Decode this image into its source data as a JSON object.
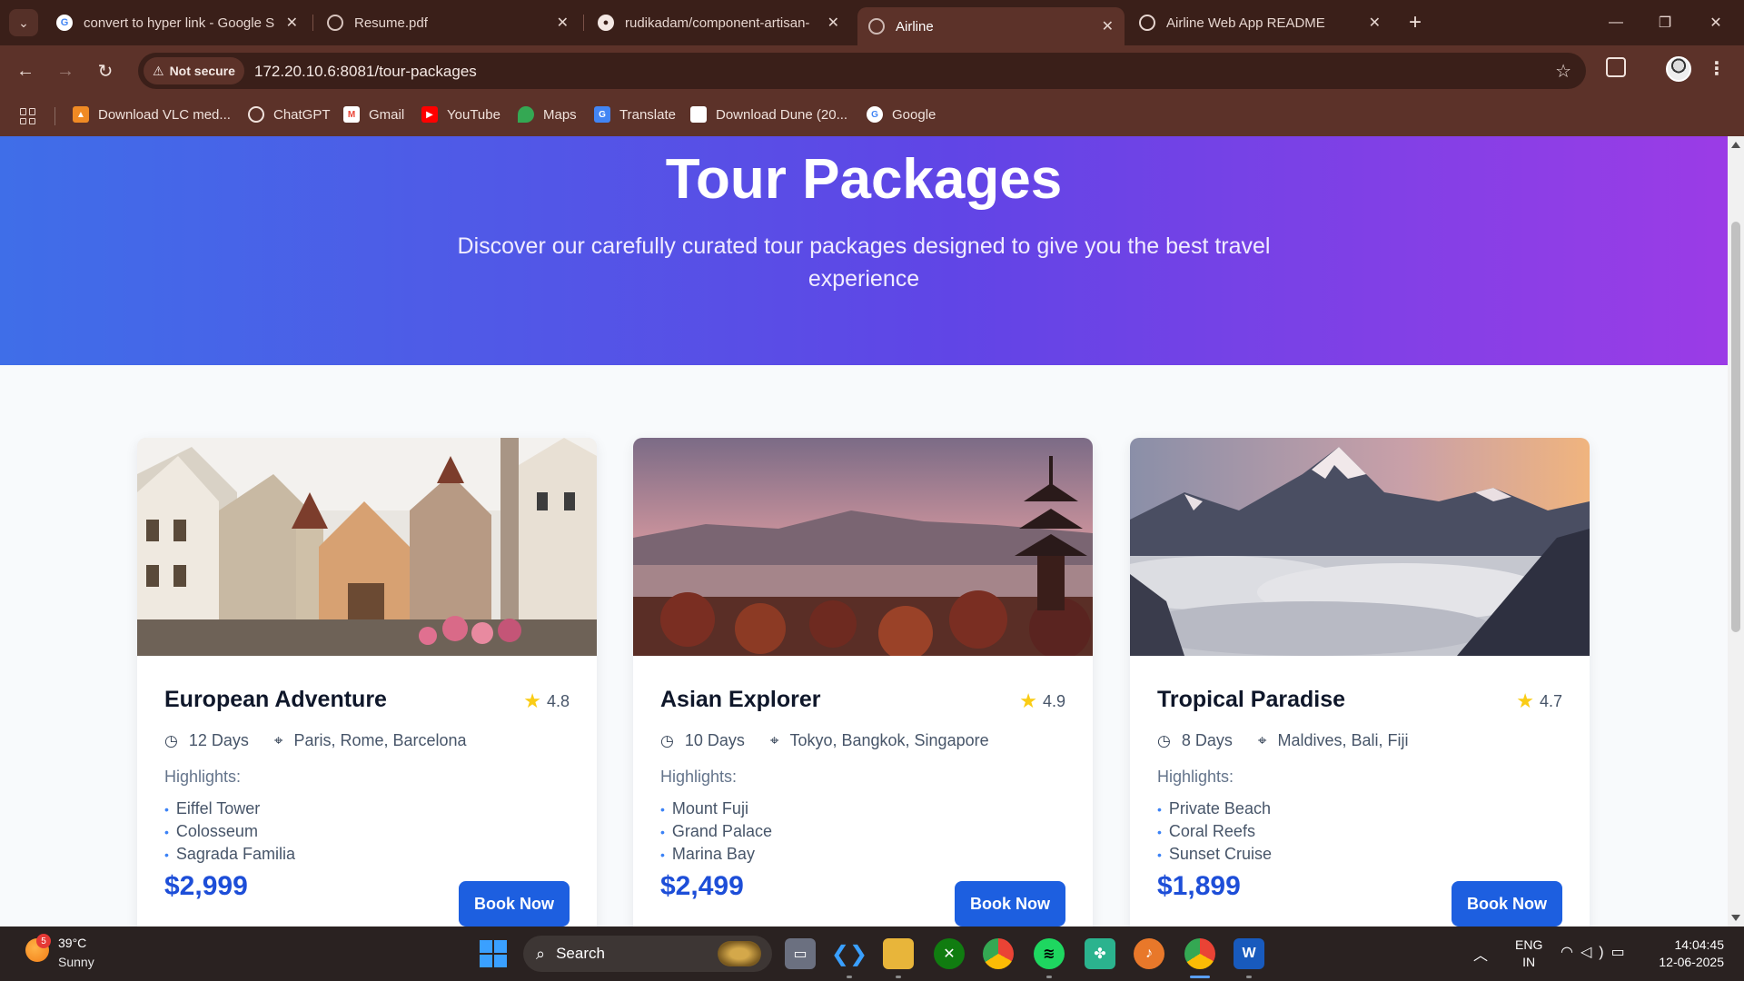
{
  "browser": {
    "tabs": [
      {
        "title": "convert to hyper link - Google S",
        "favicon": "google-icon",
        "active": false
      },
      {
        "title": "Resume.pdf",
        "favicon": "globe-icon",
        "active": false
      },
      {
        "title": "rudikadam/component-artisan-",
        "favicon": "github-icon",
        "active": false
      },
      {
        "title": "Airline",
        "favicon": "globe-icon",
        "active": true
      },
      {
        "title": "Airline Web App README",
        "favicon": "chatgpt-icon",
        "active": false
      }
    ],
    "security_label": "Not secure",
    "url": "172.20.10.6:8081/tour-packages",
    "bookmarks": [
      {
        "label": "Download VLC med...",
        "icon": "vlc-icon"
      },
      {
        "label": "ChatGPT",
        "icon": "chatgpt-icon"
      },
      {
        "label": "Gmail",
        "icon": "gmail-icon"
      },
      {
        "label": "YouTube",
        "icon": "youtube-icon"
      },
      {
        "label": "Maps",
        "icon": "maps-icon"
      },
      {
        "label": "Translate",
        "icon": "translate-icon"
      },
      {
        "label": "Download Dune (20...",
        "icon": "page-icon"
      },
      {
        "label": "Google",
        "icon": "google-icon"
      }
    ]
  },
  "hero": {
    "title": "Tour Packages",
    "subtitle": "Discover our carefully curated tour packages designed to give you the best travel experience"
  },
  "highlights_label": "Highlights:",
  "book_label": "Book Now",
  "packages": [
    {
      "name": "European Adventure",
      "rating": "4.8",
      "duration": "12 Days",
      "destinations": "Paris, Rome, Barcelona",
      "highlights": [
        "Eiffel Tower",
        "Colosseum",
        "Sagrada Familia"
      ],
      "price": "$2,999",
      "image": "european-town-photo"
    },
    {
      "name": "Asian Explorer",
      "rating": "4.9",
      "duration": "10 Days",
      "destinations": "Tokyo, Bangkok, Singapore",
      "highlights": [
        "Mount Fuji",
        "Grand Palace",
        "Marina Bay"
      ],
      "price": "$2,499",
      "image": "pagoda-city-sunset-photo"
    },
    {
      "name": "Tropical Paradise",
      "rating": "4.7",
      "duration": "8 Days",
      "destinations": "Maldives, Bali, Fiji",
      "highlights": [
        "Private Beach",
        "Coral Reefs",
        "Sunset Cruise"
      ],
      "price": "$1,899",
      "image": "mountain-clouds-photo"
    }
  ],
  "taskbar": {
    "weather_temp": "39°C",
    "weather_desc": "Sunny",
    "weather_badge": "5",
    "search_label": "Search",
    "lang_line1": "ENG",
    "lang_line2": "IN",
    "time": "14:04:45",
    "date": "12-06-2025"
  },
  "colors": {
    "hero_gradient_start": "#3f6ee8",
    "hero_gradient_end": "#9b3ce6",
    "price_color": "#1d4ed8",
    "button_color": "#1d5fe0",
    "star_color": "#facc15"
  }
}
